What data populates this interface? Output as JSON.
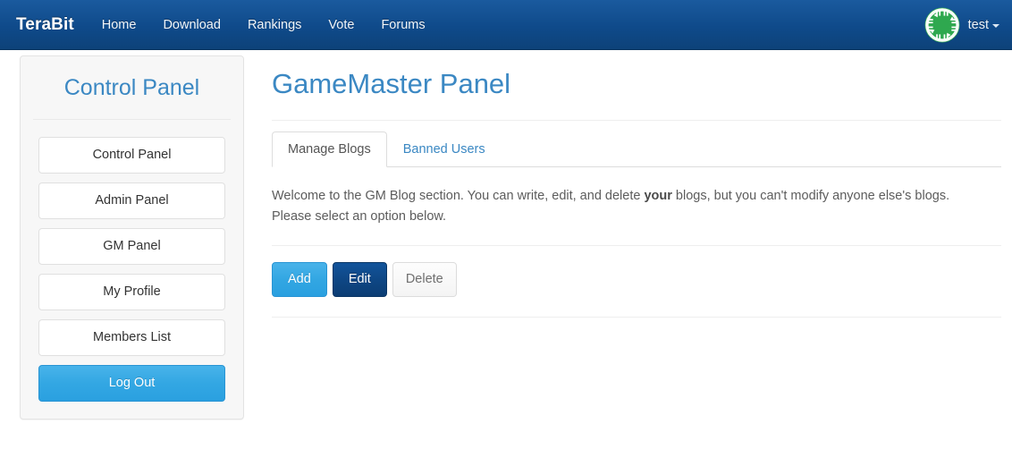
{
  "navbar": {
    "brand": "TeraBit",
    "links": [
      {
        "label": "Home"
      },
      {
        "label": "Download"
      },
      {
        "label": "Rankings"
      },
      {
        "label": "Vote"
      },
      {
        "label": "Forums"
      }
    ],
    "user": {
      "name": "test",
      "avatar_icon": "green-chip-recycle-avatar-icon",
      "caret_icon": "caret-down-icon"
    },
    "background_color": "#0f4a8a",
    "text_color": "#ffffff"
  },
  "sidebar": {
    "heading": "Control Panel",
    "heading_color": "#3b88c3",
    "items": [
      {
        "label": "Control Panel",
        "name": "control-panel",
        "style": "default"
      },
      {
        "label": "Admin Panel",
        "name": "admin-panel",
        "style": "default"
      },
      {
        "label": "GM Panel",
        "name": "gm-panel",
        "style": "default"
      },
      {
        "label": "My Profile",
        "name": "my-profile",
        "style": "default"
      },
      {
        "label": "Members List",
        "name": "members-list",
        "style": "default"
      },
      {
        "label": "Log Out",
        "name": "log-out",
        "style": "primary"
      }
    ]
  },
  "main": {
    "title": "GameMaster Panel",
    "title_color": "#3b88c3",
    "tabs": [
      {
        "label": "Manage Blogs",
        "name": "manage-blogs",
        "active": true
      },
      {
        "label": "Banned Users",
        "name": "banned-users",
        "active": false
      }
    ],
    "welcome": {
      "before": "Welcome to the GM Blog section. You can write, edit, and delete ",
      "emphasis": "your",
      "after": " blogs, but you can't modify anyone else's blogs. Please select an option below."
    },
    "actions": [
      {
        "label": "Add",
        "name": "add",
        "style": "add",
        "color": "#2aa0e0"
      },
      {
        "label": "Edit",
        "name": "edit",
        "style": "edit",
        "color": "#0e4683"
      },
      {
        "label": "Delete",
        "name": "delete",
        "style": "delete",
        "color": "#f4f4f4"
      }
    ]
  }
}
